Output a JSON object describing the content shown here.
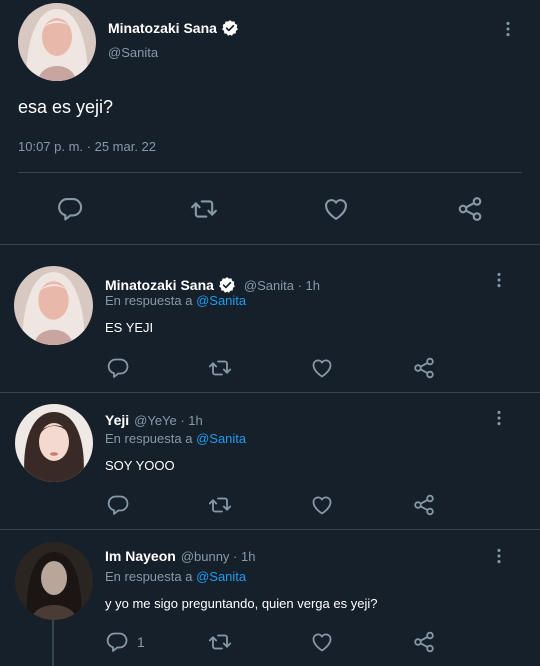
{
  "main_tweet": {
    "name": "Minatozaki Sana",
    "handle": "@Sanita",
    "text": "esa es yeji?",
    "timestamp": "10:07 p. m. · 25 mar. 22"
  },
  "replies": [
    {
      "name": "Minatozaki Sana",
      "handle_time": "@Sanita · 1h",
      "reply_prefix": "En respuesta a",
      "reply_to": "@Sanita",
      "text": "ES YEJI",
      "reply_count": ""
    },
    {
      "name": "Yeji",
      "handle_time": "@YeYe · 1h",
      "reply_prefix": "En respuesta a",
      "reply_to": "@Sanita",
      "text": "SOY YOOO",
      "reply_count": ""
    },
    {
      "name": "Im Nayeon",
      "handle_time": "@bunny · 1h",
      "reply_prefix": "En respuesta a",
      "reply_to": "@Sanita",
      "text": "y yo me sigo preguntando, quien verga es yeji?",
      "reply_count": "1"
    }
  ],
  "icons": {
    "reply": "reply-icon",
    "retweet": "retweet-icon",
    "like": "like-icon",
    "share": "share-icon",
    "more": "more-icon",
    "verified": "verified-badge-icon"
  },
  "colors": {
    "background": "#15202b",
    "link": "#1d9bf0",
    "muted": "#8899a6",
    "divider": "#38444d"
  }
}
